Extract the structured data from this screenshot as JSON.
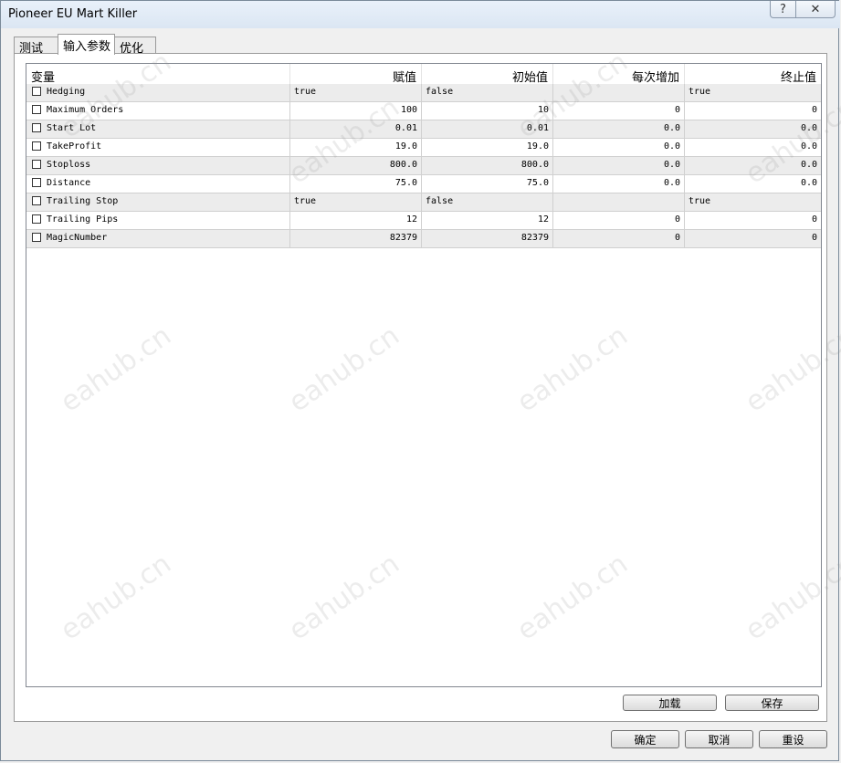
{
  "window": {
    "title": "Pioneer EU Mart Killer",
    "help_glyph": "?",
    "close_glyph": "✕"
  },
  "tabs": [
    {
      "label": "测试",
      "active": false
    },
    {
      "label": "输入参数",
      "active": true
    },
    {
      "label": "优化",
      "active": false
    }
  ],
  "table": {
    "columns": [
      "变量",
      "赋值",
      "初始值",
      "每次增加",
      "终止值"
    ],
    "rows": [
      {
        "name": "Hedging",
        "value": "true",
        "start": "false",
        "step": "",
        "stop": "true",
        "numeric": false
      },
      {
        "name": "Maximum Orders",
        "value": "100",
        "start": "10",
        "step": "0",
        "stop": "0",
        "numeric": true
      },
      {
        "name": "Start Lot",
        "value": "0.01",
        "start": "0.01",
        "step": "0.0",
        "stop": "0.0",
        "numeric": true
      },
      {
        "name": "TakeProfit",
        "value": "19.0",
        "start": "19.0",
        "step": "0.0",
        "stop": "0.0",
        "numeric": true
      },
      {
        "name": "Stoploss",
        "value": "800.0",
        "start": "800.0",
        "step": "0.0",
        "stop": "0.0",
        "numeric": true
      },
      {
        "name": "Distance",
        "value": "75.0",
        "start": "75.0",
        "step": "0.0",
        "stop": "0.0",
        "numeric": true
      },
      {
        "name": "Trailing Stop",
        "value": "true",
        "start": "false",
        "step": "",
        "stop": "true",
        "numeric": false
      },
      {
        "name": "Trailing Pips",
        "value": "12",
        "start": "12",
        "step": "0",
        "stop": "0",
        "numeric": true
      },
      {
        "name": "MagicNumber",
        "value": "82379",
        "start": "82379",
        "step": "0",
        "stop": "0",
        "numeric": true
      }
    ]
  },
  "panel_buttons": {
    "load": "加载",
    "save": "保存"
  },
  "dialog_buttons": {
    "ok": "确定",
    "cancel": "取消",
    "reset": "重设"
  },
  "watermark": "eahub.cn",
  "colors": {
    "row_alt": "#ececec",
    "row": "#ffffff"
  }
}
